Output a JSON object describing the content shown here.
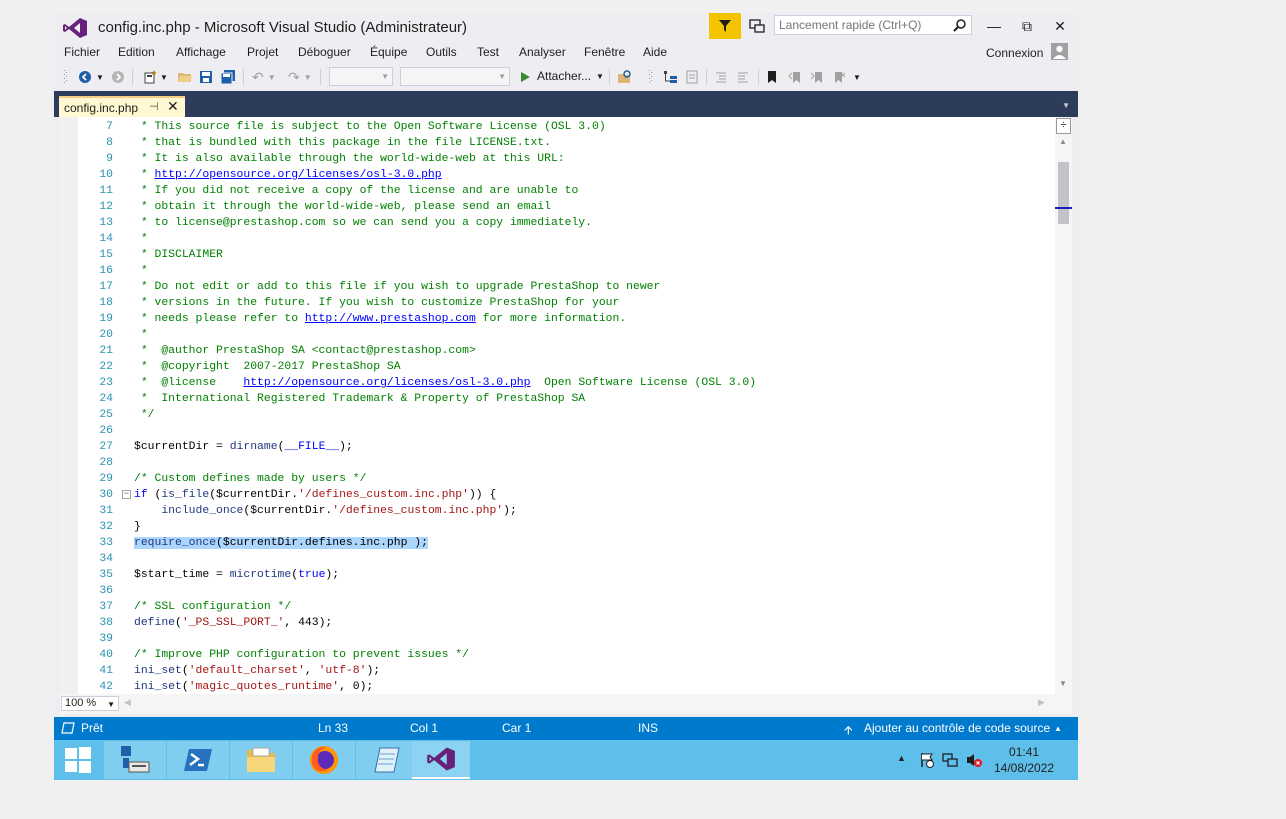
{
  "window": {
    "title": "config.inc.php - Microsoft Visual Studio  (Administrateur)",
    "quick_launch_placeholder": "Lancement rapide (Ctrl+Q)",
    "connexion_label": "Connexion"
  },
  "menu": [
    "Fichier",
    "Edition",
    "Affichage",
    "Projet",
    "Déboguer",
    "Équipe",
    "Outils",
    "Test",
    "Analyser",
    "Fenêtre",
    "Aide"
  ],
  "toolbar": {
    "attach_label": "Attacher..."
  },
  "tabs": [
    {
      "label": "config.inc.php",
      "active": true
    }
  ],
  "editor": {
    "zoom": "100 %",
    "lines": [
      {
        "n": "7",
        "text": " * This source file is subject to the Open Software License (OSL 3.0)"
      },
      {
        "n": "8",
        "text": " * that is bundled with this package in the file LICENSE.txt."
      },
      {
        "n": "9",
        "text": " * It is also available through the world-wide-web at this URL:"
      },
      {
        "n": "10",
        "text": " * http://opensource.org/licenses/osl-3.0.php"
      },
      {
        "n": "11",
        "text": " * If you did not receive a copy of the license and are unable to"
      },
      {
        "n": "12",
        "text": " * obtain it through the world-wide-web, please send an email"
      },
      {
        "n": "13",
        "text": " * to license@prestashop.com so we can send you a copy immediately."
      },
      {
        "n": "14",
        "text": " *"
      },
      {
        "n": "15",
        "text": " * DISCLAIMER"
      },
      {
        "n": "16",
        "text": " *"
      },
      {
        "n": "17",
        "text": " * Do not edit or add to this file if you wish to upgrade PrestaShop to newer"
      },
      {
        "n": "18",
        "text": " * versions in the future. If you wish to customize PrestaShop for your"
      },
      {
        "n": "19",
        "text": " * needs please refer to http://www.prestashop.com for more information."
      },
      {
        "n": "20",
        "text": " *"
      },
      {
        "n": "21",
        "text": " *  @author PrestaShop SA <contact@prestashop.com>"
      },
      {
        "n": "22",
        "text": " *  @copyright  2007-2017 PrestaShop SA"
      },
      {
        "n": "23",
        "text": " *  @license    http://opensource.org/licenses/osl-3.0.php  Open Software License (OSL 3.0)"
      },
      {
        "n": "24",
        "text": " *  International Registered Trademark & Property of PrestaShop SA"
      },
      {
        "n": "25",
        "text": " */"
      },
      {
        "n": "26",
        "text": ""
      },
      {
        "n": "27",
        "text": "$currentDir = dirname(__FILE__);"
      },
      {
        "n": "28",
        "text": ""
      },
      {
        "n": "29",
        "text": "/* Custom defines made by users */"
      },
      {
        "n": "30",
        "text": "if (is_file($currentDir.'/defines_custom.inc.php')) {"
      },
      {
        "n": "31",
        "text": "    include_once($currentDir.'/defines_custom.inc.php');"
      },
      {
        "n": "32",
        "text": "}"
      },
      {
        "n": "33",
        "text": "require_once($currentDir.defines.inc.php );"
      },
      {
        "n": "34",
        "text": ""
      },
      {
        "n": "35",
        "text": "$start_time = microtime(true);"
      },
      {
        "n": "36",
        "text": ""
      },
      {
        "n": "37",
        "text": "/* SSL configuration */"
      },
      {
        "n": "38",
        "text": "define('_PS_SSL_PORT_', 443);"
      },
      {
        "n": "39",
        "text": ""
      },
      {
        "n": "40",
        "text": "/* Improve PHP configuration to prevent issues */"
      },
      {
        "n": "41",
        "text": "ini_set('default_charset', 'utf-8');"
      },
      {
        "n": "42",
        "text": "ini_set('magic_quotes_runtime', 0);"
      }
    ]
  },
  "status": {
    "ready": "Prêt",
    "line": "Ln 33",
    "col": "Col 1",
    "car": "Car 1",
    "mode": "INS",
    "source_control": "Ajouter au contrôle de code source"
  },
  "taskbar": {
    "time": "01:41",
    "date": "14/08/2022",
    "apps": [
      "start-icon",
      "server-manager-icon",
      "powershell-icon",
      "file-explorer-icon",
      "firefox-icon",
      "notepad-icon",
      "visual-studio-icon"
    ]
  },
  "colors": {
    "accent": "#007acc",
    "tab_strip": "#2d3c5a",
    "taskbar": "#5ebfea",
    "filter_button": "#f5c400",
    "selection": "#add6ff"
  }
}
